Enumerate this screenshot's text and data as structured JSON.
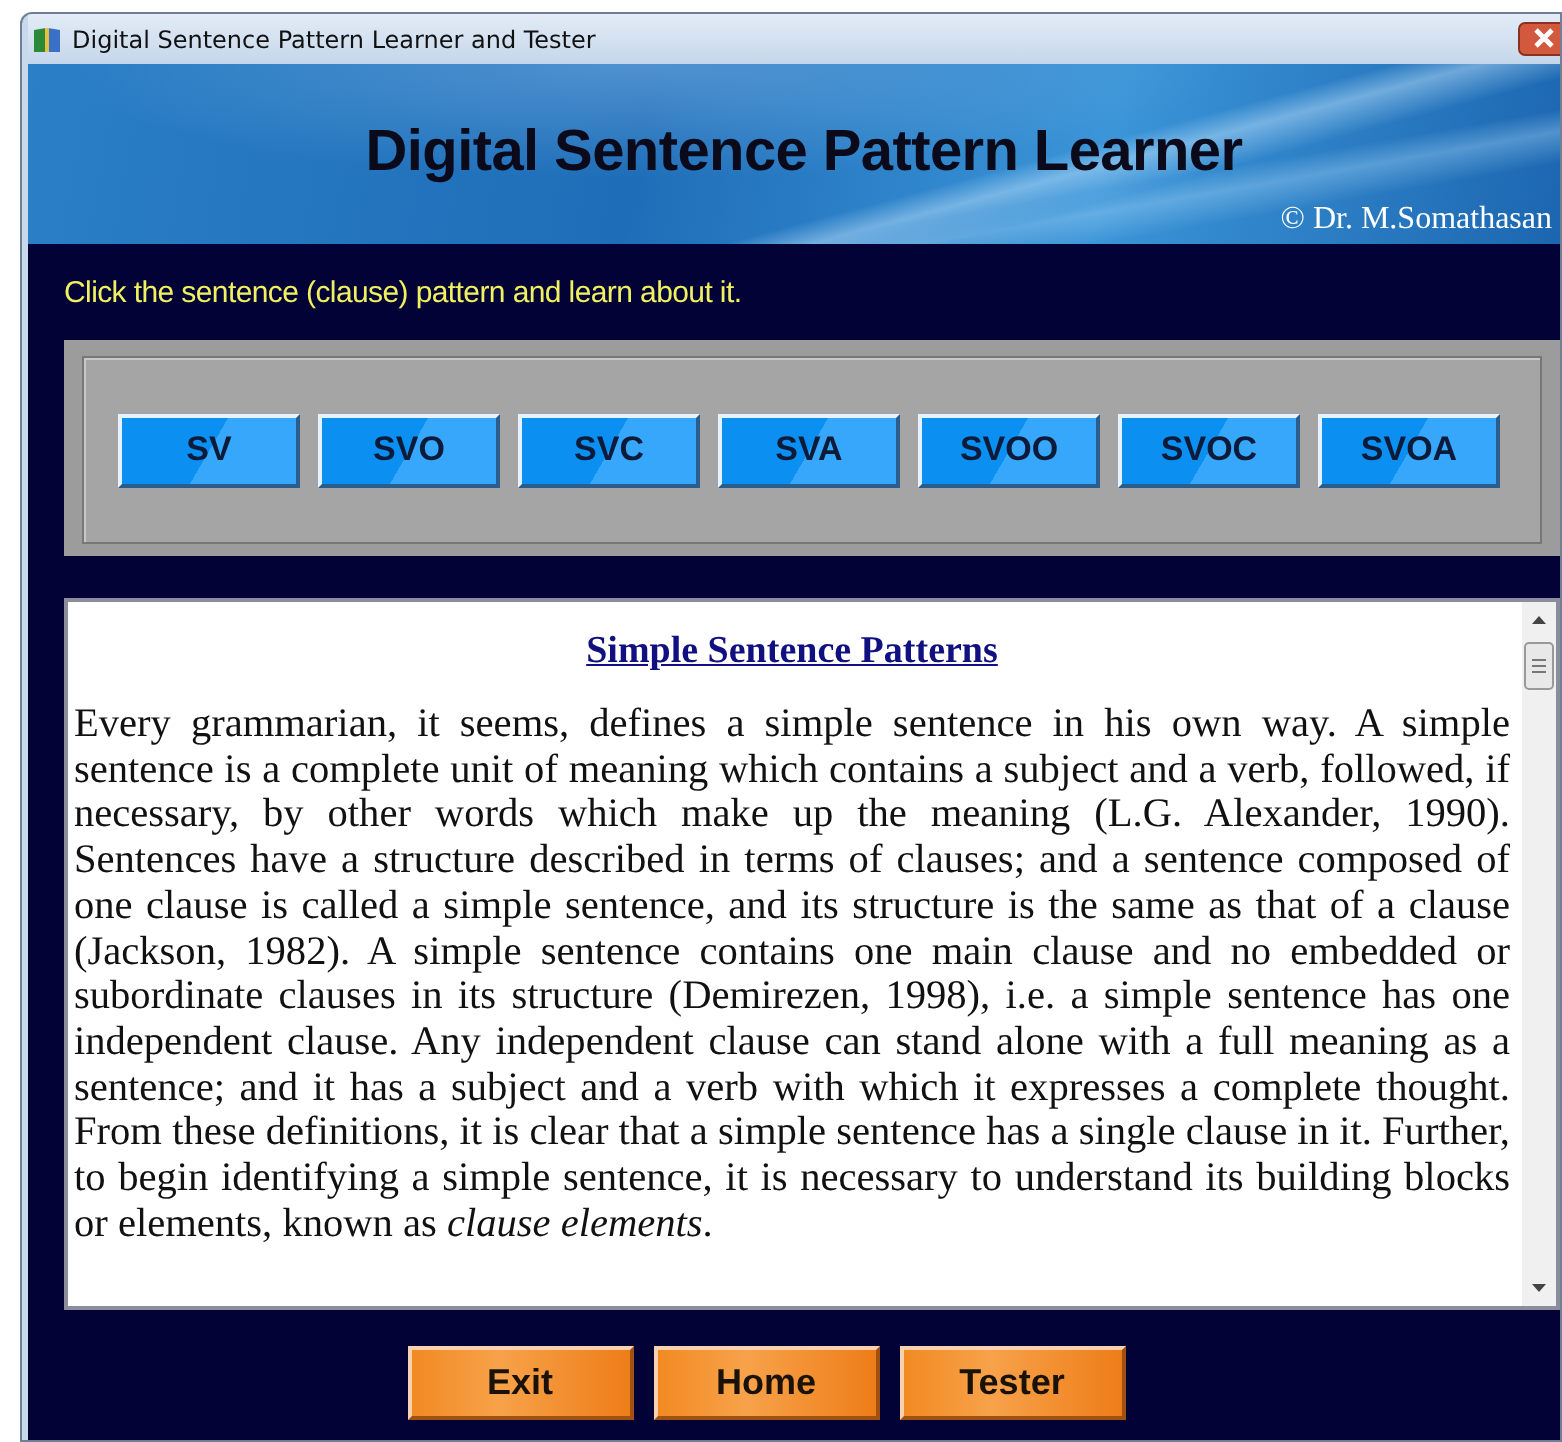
{
  "window": {
    "title": "Digital Sentence Pattern Learner and Tester"
  },
  "banner": {
    "title": "Digital Sentence Pattern Learner",
    "credit": "© Dr. M.Somathasan"
  },
  "prompt": "Click the sentence (clause) pattern and learn about it.",
  "patterns": [
    "SV",
    "SVO",
    "SVC",
    "SVA",
    "SVOO",
    "SVOC",
    "SVOA"
  ],
  "article": {
    "heading": "Simple Sentence Patterns",
    "body": "Every grammarian, it seems, defines a simple sentence in his own way. A simple sentence is a complete unit of meaning which contains a subject and a verb, followed, if necessary, by other words which make up the meaning (L.G. Alexander, 1990). Sentences have a structure described in terms of clauses; and a sentence composed of one clause is called a simple sentence, and its structure is the same as that of a clause (Jackson, 1982). A simple sentence contains one main clause and no embedded or subordinate clauses in its structure (Demirezen, 1998), i.e. a simple sentence has one independent clause. Any independent clause can stand alone with a full meaning as a sentence; and it has a subject and a verb with which it expresses a complete thought. From these definitions, it is clear that a simple sentence has a single clause in it. Further, to begin identifying a simple sentence, it is necessary to understand its building blocks or elements, known as *clause elements*."
  },
  "buttons": [
    "Exit",
    "Home",
    "Tester"
  ]
}
